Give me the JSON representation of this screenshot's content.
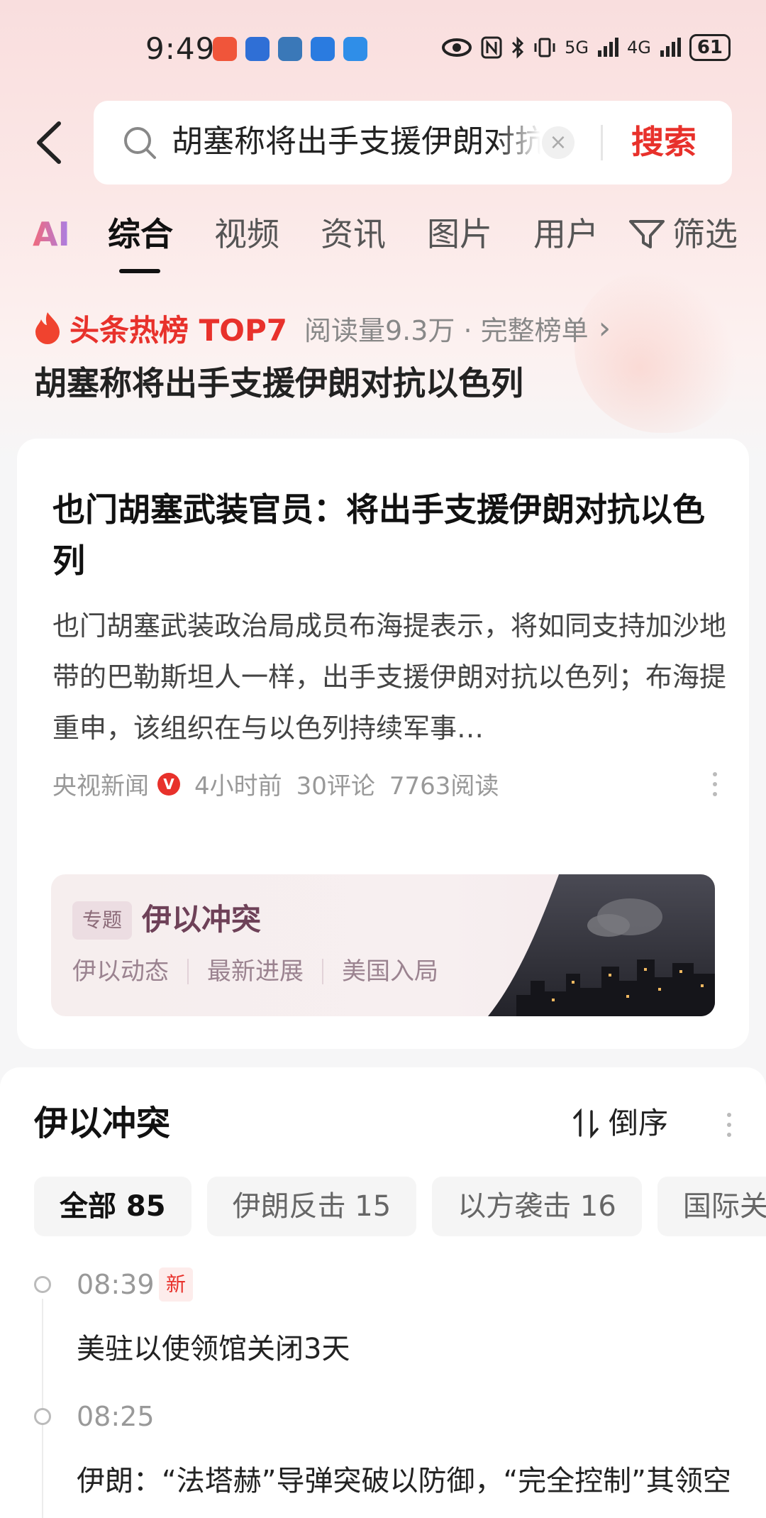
{
  "status_bar": {
    "time": "9:49",
    "network_5g": "5G",
    "network_4g": "4G",
    "battery": "61",
    "app_icons": [
      "app-icon-1",
      "app-icon-2",
      "app-icon-3",
      "app-icon-4",
      "app-icon-5"
    ],
    "icon_colors": [
      "#f0553a",
      "#2f6fd6",
      "#3a78b8",
      "#2a7be0",
      "#2f8ee8"
    ]
  },
  "search": {
    "query": "胡塞称将出手支援伊朗对抗以色列",
    "clear_symbol": "×",
    "button_label": "搜索"
  },
  "tabs": {
    "ai": "AI",
    "items": [
      "综合",
      "视频",
      "资讯",
      "图片",
      "用户"
    ],
    "active_index": 0,
    "filter_label": "筛选"
  },
  "hot_list": {
    "label": "头条热榜 TOP7",
    "meta": "阅读量9.3万 · 完整榜单",
    "chevron": "›",
    "title": "胡塞称将出手支援伊朗对抗以色列"
  },
  "article": {
    "title": "也门胡塞武装官员：将出手支援伊朗对抗以色列",
    "abstract": "也门胡塞武装政治局成员布海提表示，将如同支持加沙地带的巴勒斯坦人一样，出手支援伊朗对抗以色列；布海提重申，该组织在与以色列持续军事…",
    "source": "央视新闻",
    "verified_mark": "V",
    "time": "4小时前",
    "comments": "30评论",
    "reads": "7763阅读"
  },
  "topic": {
    "tag": "专题",
    "title": "伊以冲突",
    "links": [
      "伊以动态",
      "最新进展",
      "美国入局"
    ]
  },
  "timeline": {
    "title": "伊以冲突",
    "sort_label": "倒序",
    "chips": [
      "全部 85",
      "伊朗反击 15",
      "以方袭击 16",
      "国际关"
    ],
    "active_chip": 0,
    "items": [
      {
        "time": "08:39",
        "badge": "新",
        "text": "美驻以使领馆关闭3天"
      },
      {
        "time": "08:25",
        "badge": "",
        "text": "伊朗：“法塔赫”导弹突破以防御，“完全控制”其领空"
      }
    ]
  },
  "colors": {
    "accent": "#e8312b",
    "topic_text": "#6e4158"
  }
}
